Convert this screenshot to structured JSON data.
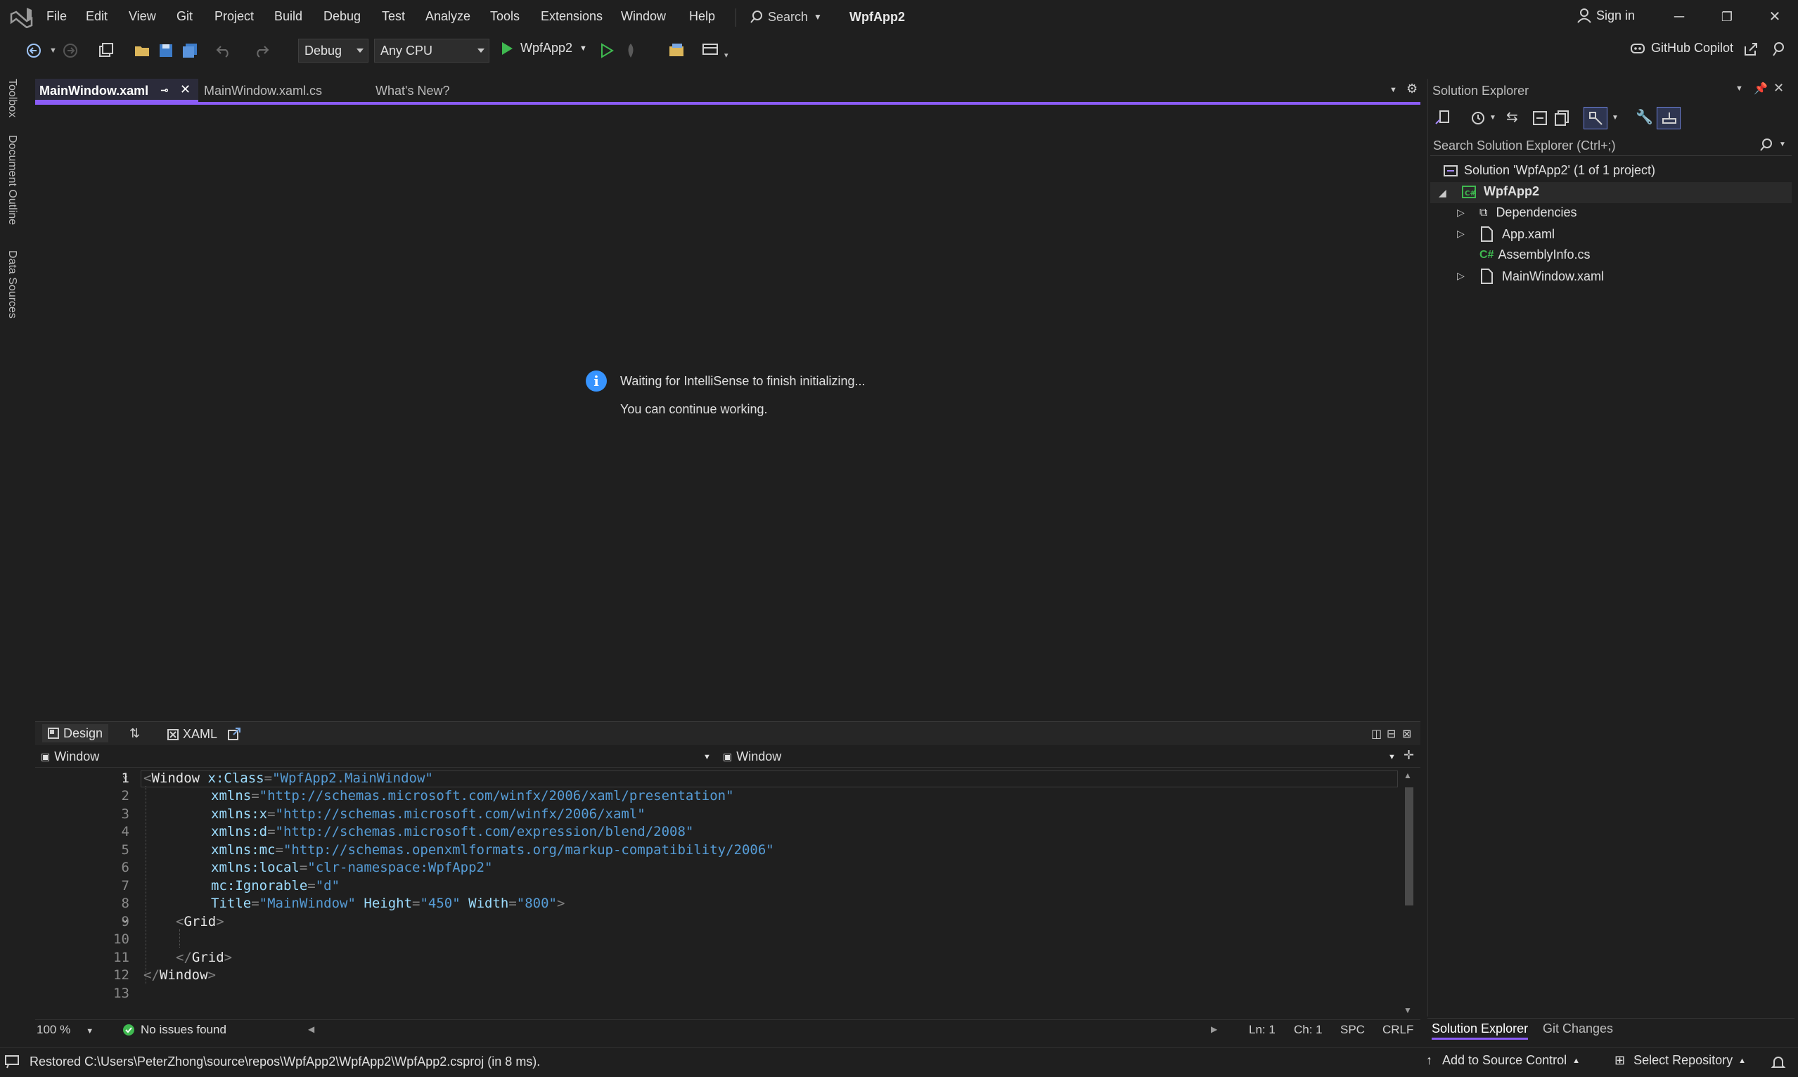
{
  "menu": {
    "items": [
      "File",
      "Edit",
      "View",
      "Git",
      "Project",
      "Build",
      "Debug",
      "Test",
      "Analyze",
      "Tools",
      "Extensions",
      "Window",
      "Help"
    ],
    "search_label": "Search",
    "app_title": "WpfApp2",
    "sign_in": "Sign in"
  },
  "toolbar": {
    "config": "Debug",
    "platform": "Any CPU",
    "run_target": "WpfApp2",
    "copilot": "GitHub Copilot"
  },
  "left_rail": {
    "tabs": [
      "Toolbox",
      "Document Outline",
      "Data Sources"
    ]
  },
  "doc_tabs": {
    "tabs": [
      "MainWindow.xaml",
      "MainWindow.xaml.cs",
      "What's New?"
    ]
  },
  "designer": {
    "info_line1": "Waiting for IntelliSense to finish initializing...",
    "info_line2": "You can continue working.",
    "design_tab": "Design",
    "xaml_tab": "XAML",
    "nav_left": "Window",
    "nav_right": "Window"
  },
  "editor": {
    "line_numbers": [
      "1",
      "2",
      "3",
      "4",
      "5",
      "6",
      "7",
      "8",
      "9",
      "10",
      "11",
      "12",
      "13"
    ],
    "zoom": "100 %",
    "issues": "No issues found",
    "ln": "Ln: 1",
    "ch": "Ch: 1",
    "spc": "SPC",
    "crlf": "CRLF",
    "code": {
      "l1_el": "Window",
      "l1_attr": "x:Class",
      "l1_val": "\"WpfApp2.MainWindow\"",
      "l2_attr": "xmlns",
      "l2_val": "\"http://schemas.microsoft.com/winfx/2006/xaml/presentation\"",
      "l3_attr": "xmlns:x",
      "l3_val": "\"http://schemas.microsoft.com/winfx/2006/xaml\"",
      "l4_attr": "xmlns:d",
      "l4_val": "\"http://schemas.microsoft.com/expression/blend/2008\"",
      "l5_attr": "xmlns:mc",
      "l5_val": "\"http://schemas.openxmlformats.org/markup-compatibility/2006\"",
      "l6_attr": "xmlns:local",
      "l6_val": "\"clr-namespace:WpfApp2\"",
      "l7_attr": "mc:Ignorable",
      "l7_val": "\"d\"",
      "l8_attr1": "Title",
      "l8_val1": "\"MainWindow\"",
      "l8_attr2": "Height",
      "l8_val2": "\"450\"",
      "l8_attr3": "Width",
      "l8_val3": "\"800\"",
      "l9_el": "Grid",
      "l11_el": "Grid",
      "l12_el": "Window"
    }
  },
  "solution_explorer": {
    "title": "Solution Explorer",
    "search_placeholder": "Search Solution Explorer (Ctrl+;)",
    "solution": "Solution 'WpfApp2' (1 of 1 project)",
    "project": "WpfApp2",
    "items": [
      "Dependencies",
      "App.xaml",
      "AssemblyInfo.cs",
      "MainWindow.xaml"
    ],
    "bottom_tabs": [
      "Solution Explorer",
      "Git Changes"
    ]
  },
  "statusbar": {
    "message": "Restored C:\\Users\\PeterZhong\\source\\repos\\WpfApp2\\WpfApp2\\WpfApp2.csproj (in 8 ms).",
    "add_source": "Add to Source Control",
    "select_repo": "Select Repository"
  },
  "colors": {
    "accent": "#8b5cf6",
    "info": "#3794ff",
    "ok": "#3fb950",
    "run": "#3fb950"
  }
}
